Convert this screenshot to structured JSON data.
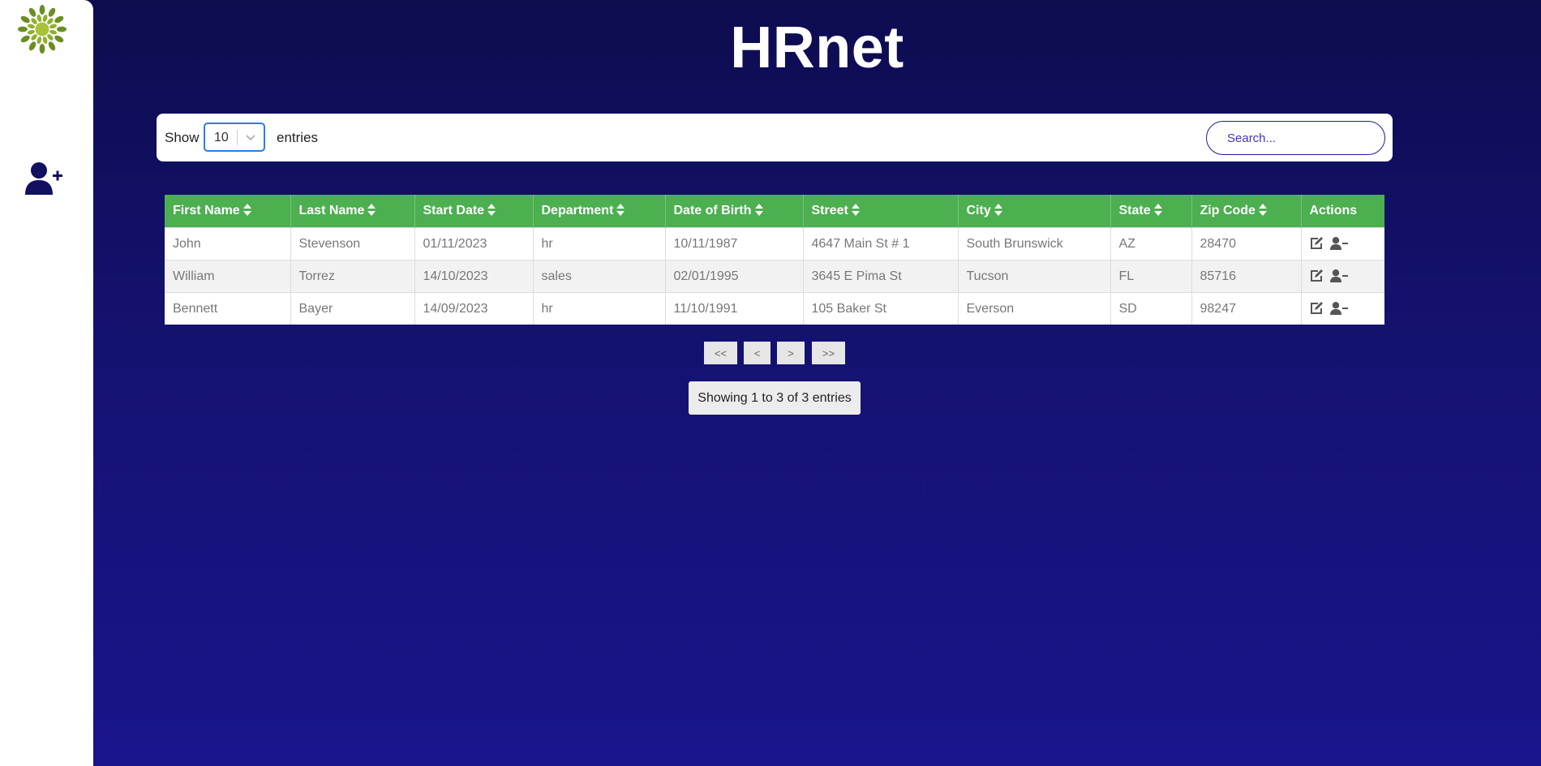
{
  "app": {
    "title": "HRnet"
  },
  "sidebar": {
    "logo": "flower-logo",
    "add_employee_icon": "user-plus-icon"
  },
  "controls": {
    "show_label": "Show",
    "page_size": "10",
    "entries_label": "entries",
    "search_placeholder": "Search..."
  },
  "table": {
    "columns": [
      "First Name",
      "Last Name",
      "Start Date",
      "Department",
      "Date of Birth",
      "Street",
      "City",
      "State",
      "Zip Code",
      "Actions"
    ],
    "rows": [
      [
        "John",
        "Stevenson",
        "01/11/2023",
        "hr",
        "10/11/1987",
        "4647 Main St # 1",
        "South Brunswick",
        "AZ",
        "28470"
      ],
      [
        "William",
        "Torrez",
        "14/10/2023",
        "sales",
        "02/01/1995",
        "3645 E Pima St",
        "Tucson",
        "FL",
        "85716"
      ],
      [
        "Bennett",
        "Bayer",
        "14/09/2023",
        "hr",
        "11/10/1991",
        "105 Baker St",
        "Everson",
        "SD",
        "98247"
      ]
    ],
    "row_action_icons": [
      "edit-icon",
      "user-minus-icon"
    ]
  },
  "pagination": {
    "first": "<<",
    "prev": "<",
    "next": ">",
    "last": ">>"
  },
  "info": "Showing 1 to 3 of 3 entries",
  "colors": {
    "header_green": "#4caf50",
    "background": "#141270",
    "accent_blue": "#2a7de1"
  }
}
